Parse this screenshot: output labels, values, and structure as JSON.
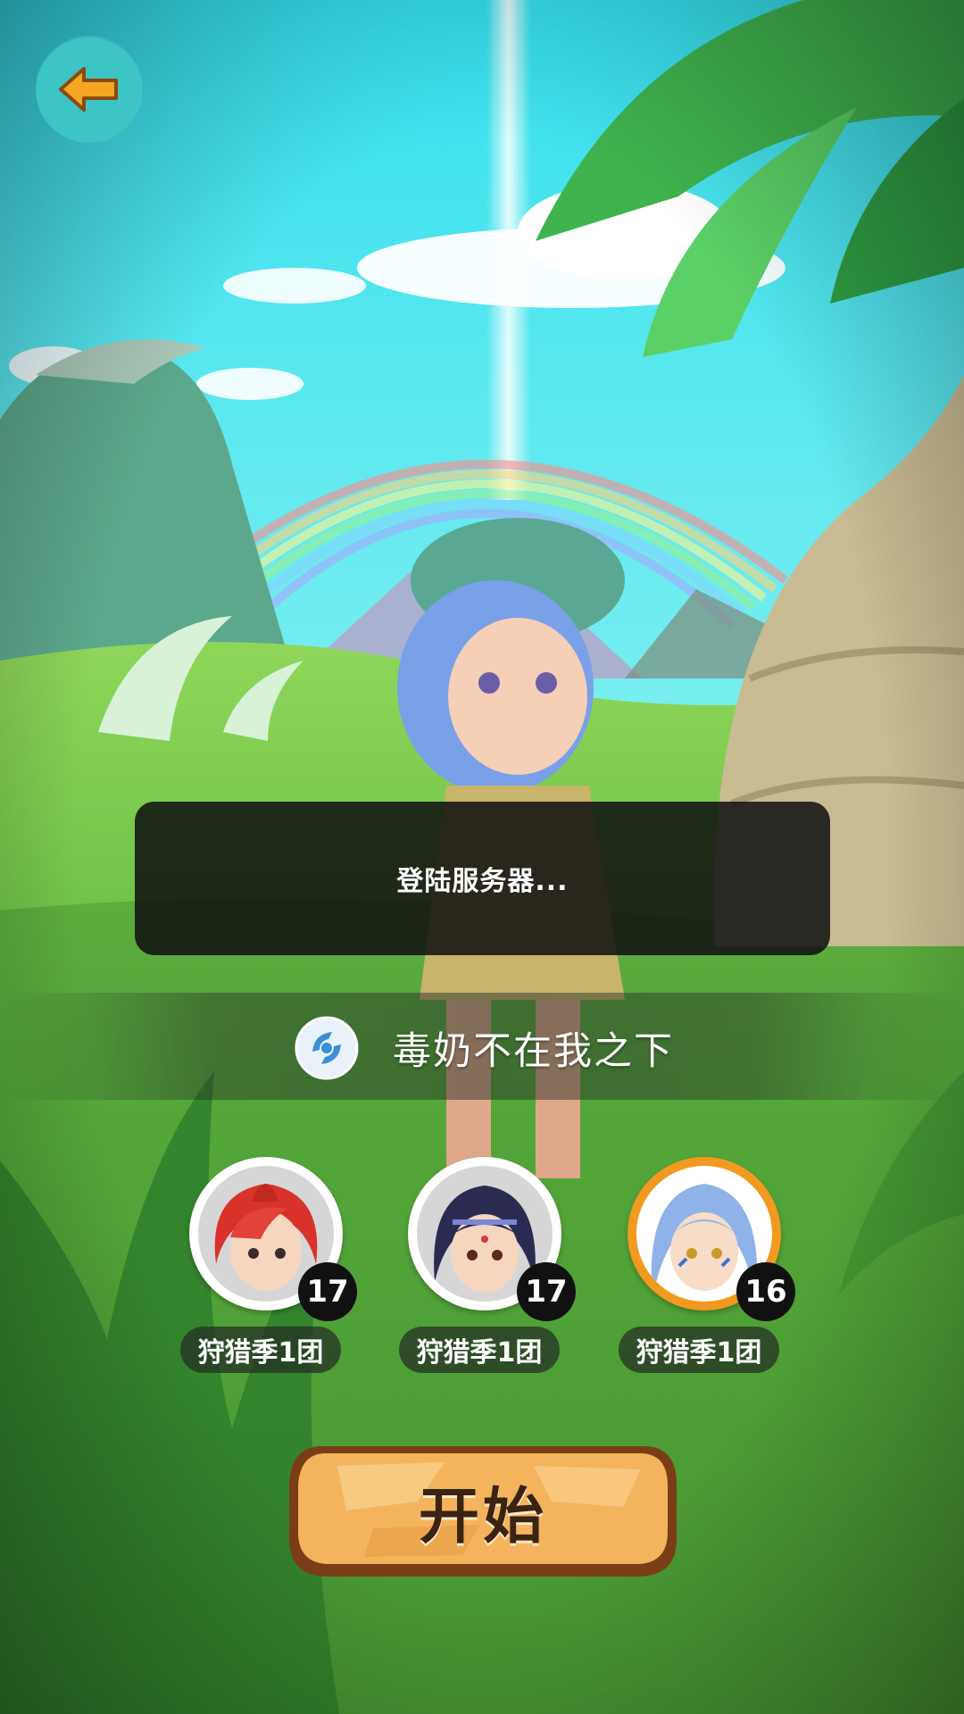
{
  "toast": {
    "message": "登陆服务器..."
  },
  "server": {
    "name": "毒奶不在我之下",
    "icon": "server-logo-icon"
  },
  "team": [
    {
      "level": "17",
      "label": "狩猎季1团",
      "hair": "red",
      "selected": false
    },
    {
      "level": "17",
      "label": "狩猎季1团",
      "hair": "dark",
      "selected": false
    },
    {
      "level": "16",
      "label": "狩猎季1团",
      "hair": "blue",
      "selected": true
    }
  ],
  "start_button": {
    "label": "开始"
  },
  "colors": {
    "back_button": "#3cc5c4",
    "back_arrow": "#f5a623",
    "selected_ring": "#f29a1f",
    "start_button": "#f4b45e"
  }
}
